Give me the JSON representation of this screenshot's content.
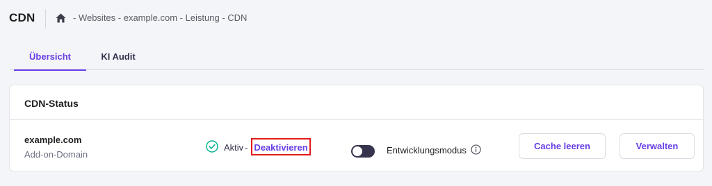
{
  "header": {
    "title": "CDN",
    "breadcrumb": "- Websites - example.com - Leistung - CDN"
  },
  "tabs": [
    {
      "label": "Übersicht",
      "active": true
    },
    {
      "label": "KI Audit",
      "active": false
    }
  ],
  "cdn_status": {
    "title": "CDN-Status",
    "domain": "example.com",
    "domain_type": "Add-on-Domain",
    "status_label": "Aktiv",
    "status_separator": "-",
    "deactivate_label": "Deaktivieren",
    "dev_mode_label": "Entwicklungsmodus",
    "dev_mode_enabled": false,
    "clear_cache_label": "Cache leeren",
    "manage_label": "Verwalten"
  },
  "colors": {
    "accent": "#673de6",
    "success": "#00b090",
    "highlight_box": "#e21a1a",
    "background": "#f4f5f8"
  },
  "icons": {
    "home": "home-icon",
    "status": "check-circle-icon",
    "info": "info-icon"
  }
}
